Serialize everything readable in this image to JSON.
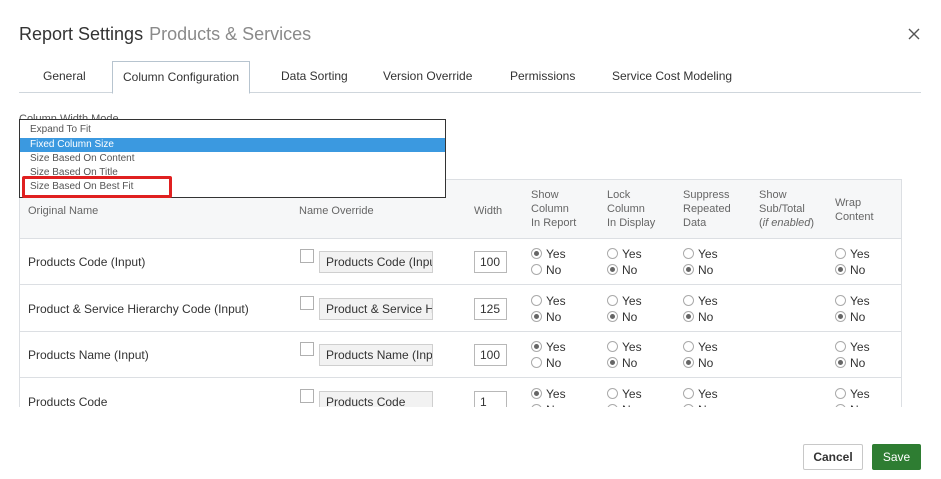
{
  "header": {
    "title": "Report Settings",
    "subtitle": "Products & Services"
  },
  "tabs": [
    {
      "label": "General"
    },
    {
      "label": "Column Configuration"
    },
    {
      "label": "Data Sorting"
    },
    {
      "label": "Version Override"
    },
    {
      "label": "Permissions"
    },
    {
      "label": "Service Cost Modeling"
    }
  ],
  "column_width_mode": {
    "label": "Column Width Mode",
    "options": [
      "Expand To Fit",
      "Fixed Column Size",
      "Size Based On Content",
      "Size Based On Title",
      "Size Based On Best Fit"
    ],
    "selected": "Fixed Column Size"
  },
  "columns": {
    "original_name": "Original Name",
    "name_override": "Name Override",
    "width": "Width",
    "show_l1": "Show",
    "show_l2": "Column",
    "show_l3": "In Report",
    "lock_l1": "Lock",
    "lock_l2": "Column",
    "lock_l3": "In Display",
    "suppress_l1": "Suppress",
    "suppress_l2": "Repeated",
    "suppress_l3": "Data",
    "subtotal_l1": "Show",
    "subtotal_l2": "Sub/Total",
    "subtotal_l3": "if enabled",
    "wrap_l1": "Wrap",
    "wrap_l2": "Content"
  },
  "radio_labels": {
    "yes": "Yes",
    "no": "No"
  },
  "rows": [
    {
      "name": "Products Code (Input)",
      "override": "Products Code (Inpu",
      "width": "100",
      "show": "yes",
      "lock": "no",
      "suppress": "no",
      "wrap": "no"
    },
    {
      "name": "Product & Service Hierarchy Code (Input)",
      "override": "Product & Service H",
      "width": "125",
      "show": "no",
      "lock": "no",
      "suppress": "no",
      "wrap": "no"
    },
    {
      "name": "Products Name (Input)",
      "override": "Products Name (Inp",
      "width": "100",
      "show": "yes",
      "lock": "no",
      "suppress": "no",
      "wrap": "no"
    },
    {
      "name": "Products Code",
      "override": "Products Code",
      "width": "1",
      "show": "yes",
      "lock": "no",
      "suppress": "no",
      "wrap": "no"
    }
  ],
  "footer": {
    "cancel_label": "Cancel",
    "save_label": "Save"
  },
  "colors": {
    "accent_blue": "#3b99e0",
    "save_green": "#2e7d32",
    "highlight_red": "#e02020"
  }
}
